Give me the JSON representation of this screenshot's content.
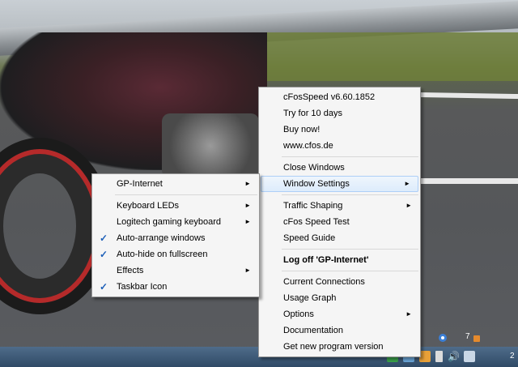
{
  "main_menu": {
    "items": [
      {
        "label": "cFosSpeed v6.60.1852"
      },
      {
        "label": "Try for 10 days"
      },
      {
        "label": "Buy now!"
      },
      {
        "label": "www.cfos.de"
      },
      {
        "label": "Close Windows"
      },
      {
        "label": "Window Settings"
      },
      {
        "label": "Traffic Shaping"
      },
      {
        "label": "cFos Speed Test"
      },
      {
        "label": "Speed Guide"
      },
      {
        "label": "Log off 'GP-Internet'"
      },
      {
        "label": "Current Connections"
      },
      {
        "label": "Usage Graph"
      },
      {
        "label": "Options"
      },
      {
        "label": "Documentation"
      },
      {
        "label": "Get new program version"
      }
    ]
  },
  "sub_menu": {
    "items": [
      {
        "label": "GP-Internet",
        "checked": false
      },
      {
        "label": "Keyboard LEDs",
        "checked": false
      },
      {
        "label": "Logitech gaming keyboard",
        "checked": false
      },
      {
        "label": "Auto-arrange windows",
        "checked": true
      },
      {
        "label": "Auto-hide on fullscreen",
        "checked": true
      },
      {
        "label": "Effects",
        "checked": false
      },
      {
        "label": "Taskbar Icon",
        "checked": true
      }
    ]
  },
  "symbols": {
    "arrow": "►",
    "check": "✓"
  },
  "taskbar": {
    "notification_count": "7",
    "clock_fragment": "2"
  },
  "colors": {
    "menu_bg": "#f5f5f5",
    "highlight": "#dcebfb",
    "check": "#1d5fb8",
    "taskbar": "#3a5878"
  }
}
